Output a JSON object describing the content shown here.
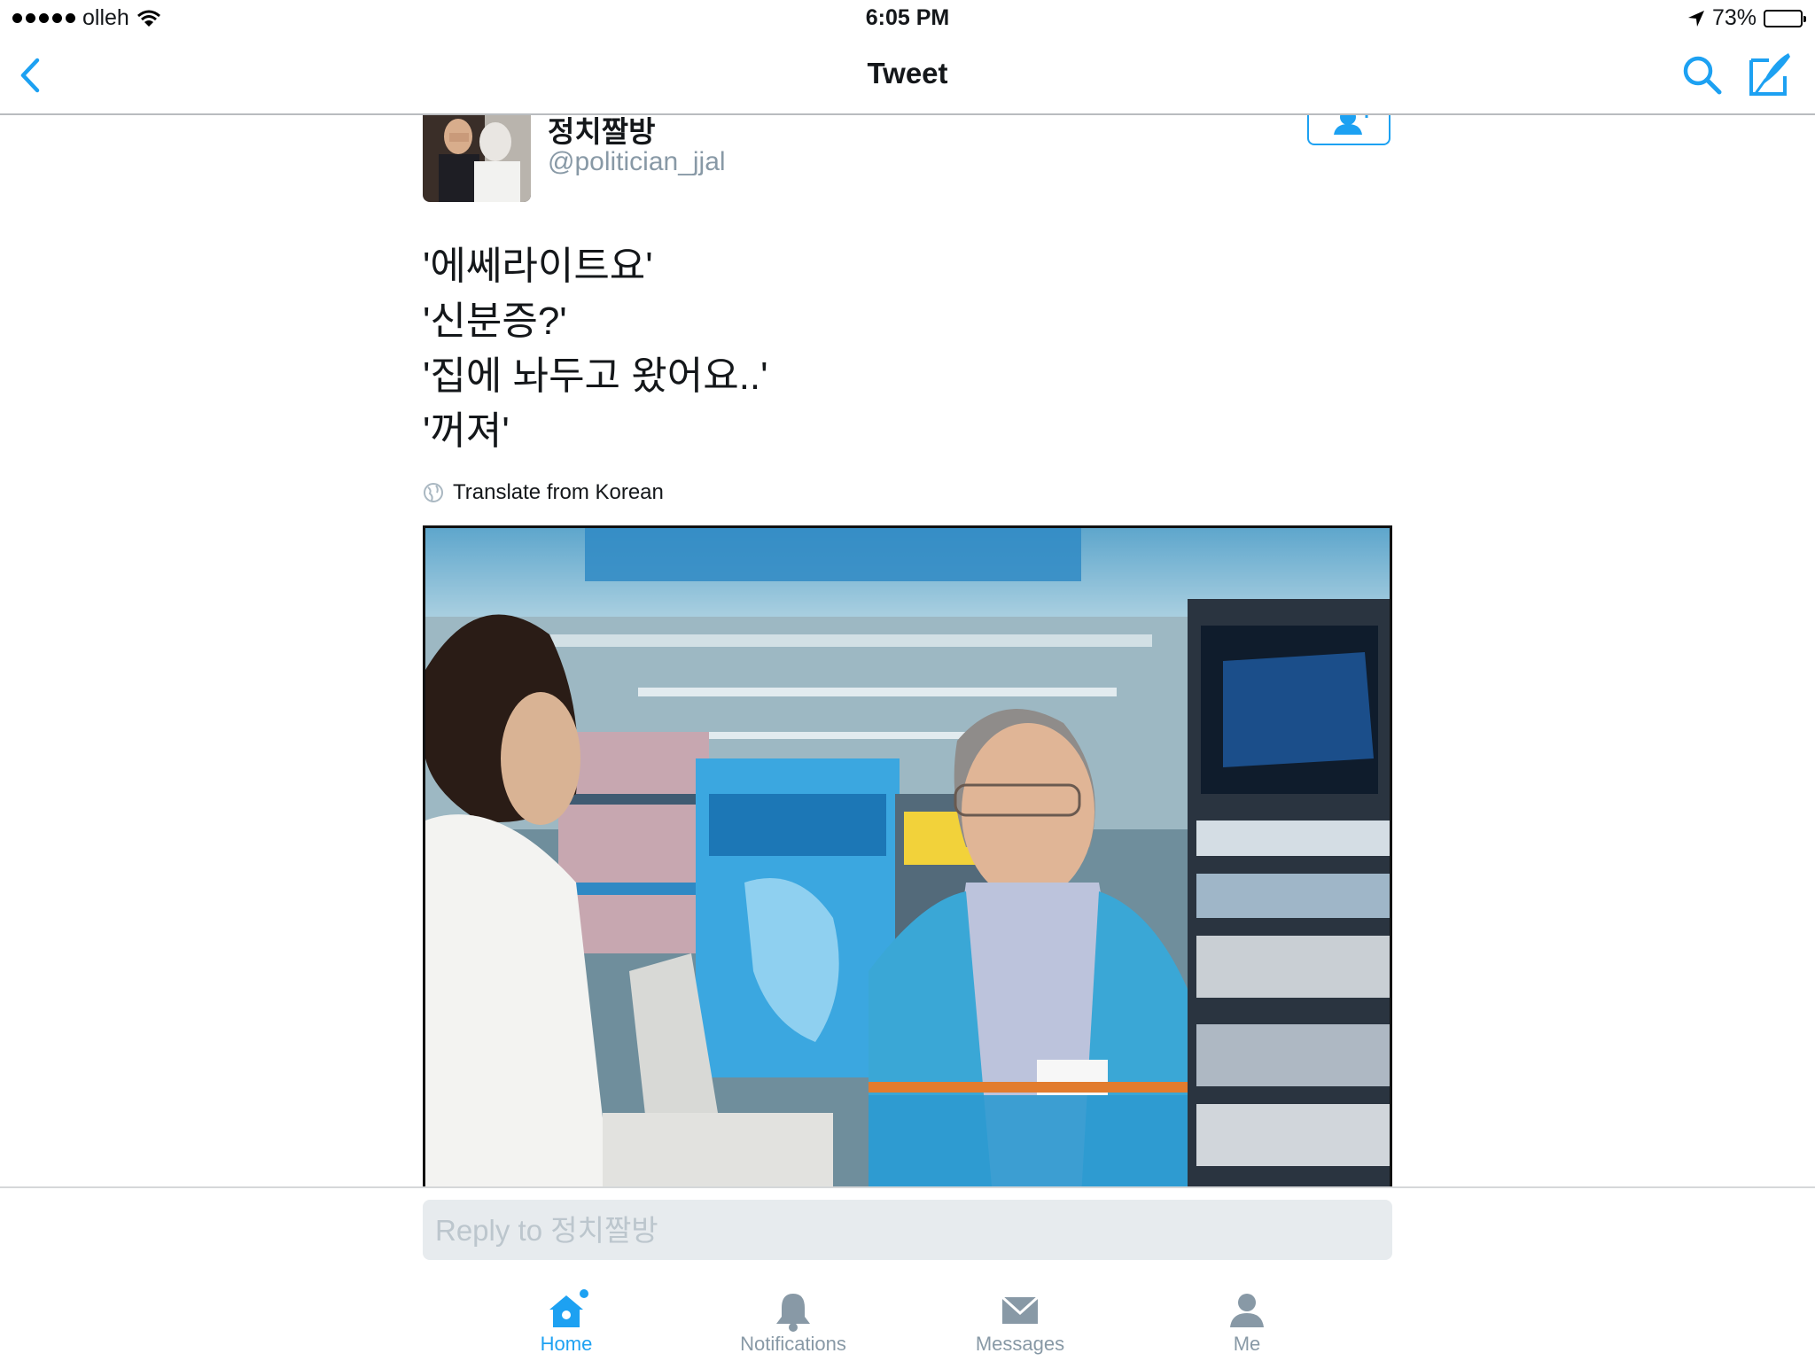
{
  "status_bar": {
    "carrier": "olleh",
    "time": "6:05 PM",
    "battery_percent": "73%",
    "battery_level": 0.73
  },
  "nav": {
    "title": "Tweet",
    "back_icon": "chevron-left-icon",
    "search_icon": "search-icon",
    "compose_icon": "compose-icon"
  },
  "tweet": {
    "author_name": "정치짤방",
    "author_handle": "@politician_jjal",
    "lines": [
      "'에쎄라이트요'",
      "'신분증?'",
      "'집에 놔두고 왔어요..'",
      "'꺼져'"
    ],
    "translate_label": "Translate from Korean"
  },
  "reply": {
    "placeholder": "Reply to 정치짤방"
  },
  "tab_bar": {
    "tabs": [
      {
        "label": "Home",
        "icon": "home-icon",
        "active": true
      },
      {
        "label": "Notifications",
        "icon": "bell-icon",
        "active": false
      },
      {
        "label": "Messages",
        "icon": "envelope-icon",
        "active": false
      },
      {
        "label": "Me",
        "icon": "person-icon",
        "active": false
      }
    ]
  },
  "colors": {
    "accent": "#1da1f2",
    "text": "#14171a",
    "secondary": "#8899a6",
    "divider": "#b9bcbf"
  }
}
